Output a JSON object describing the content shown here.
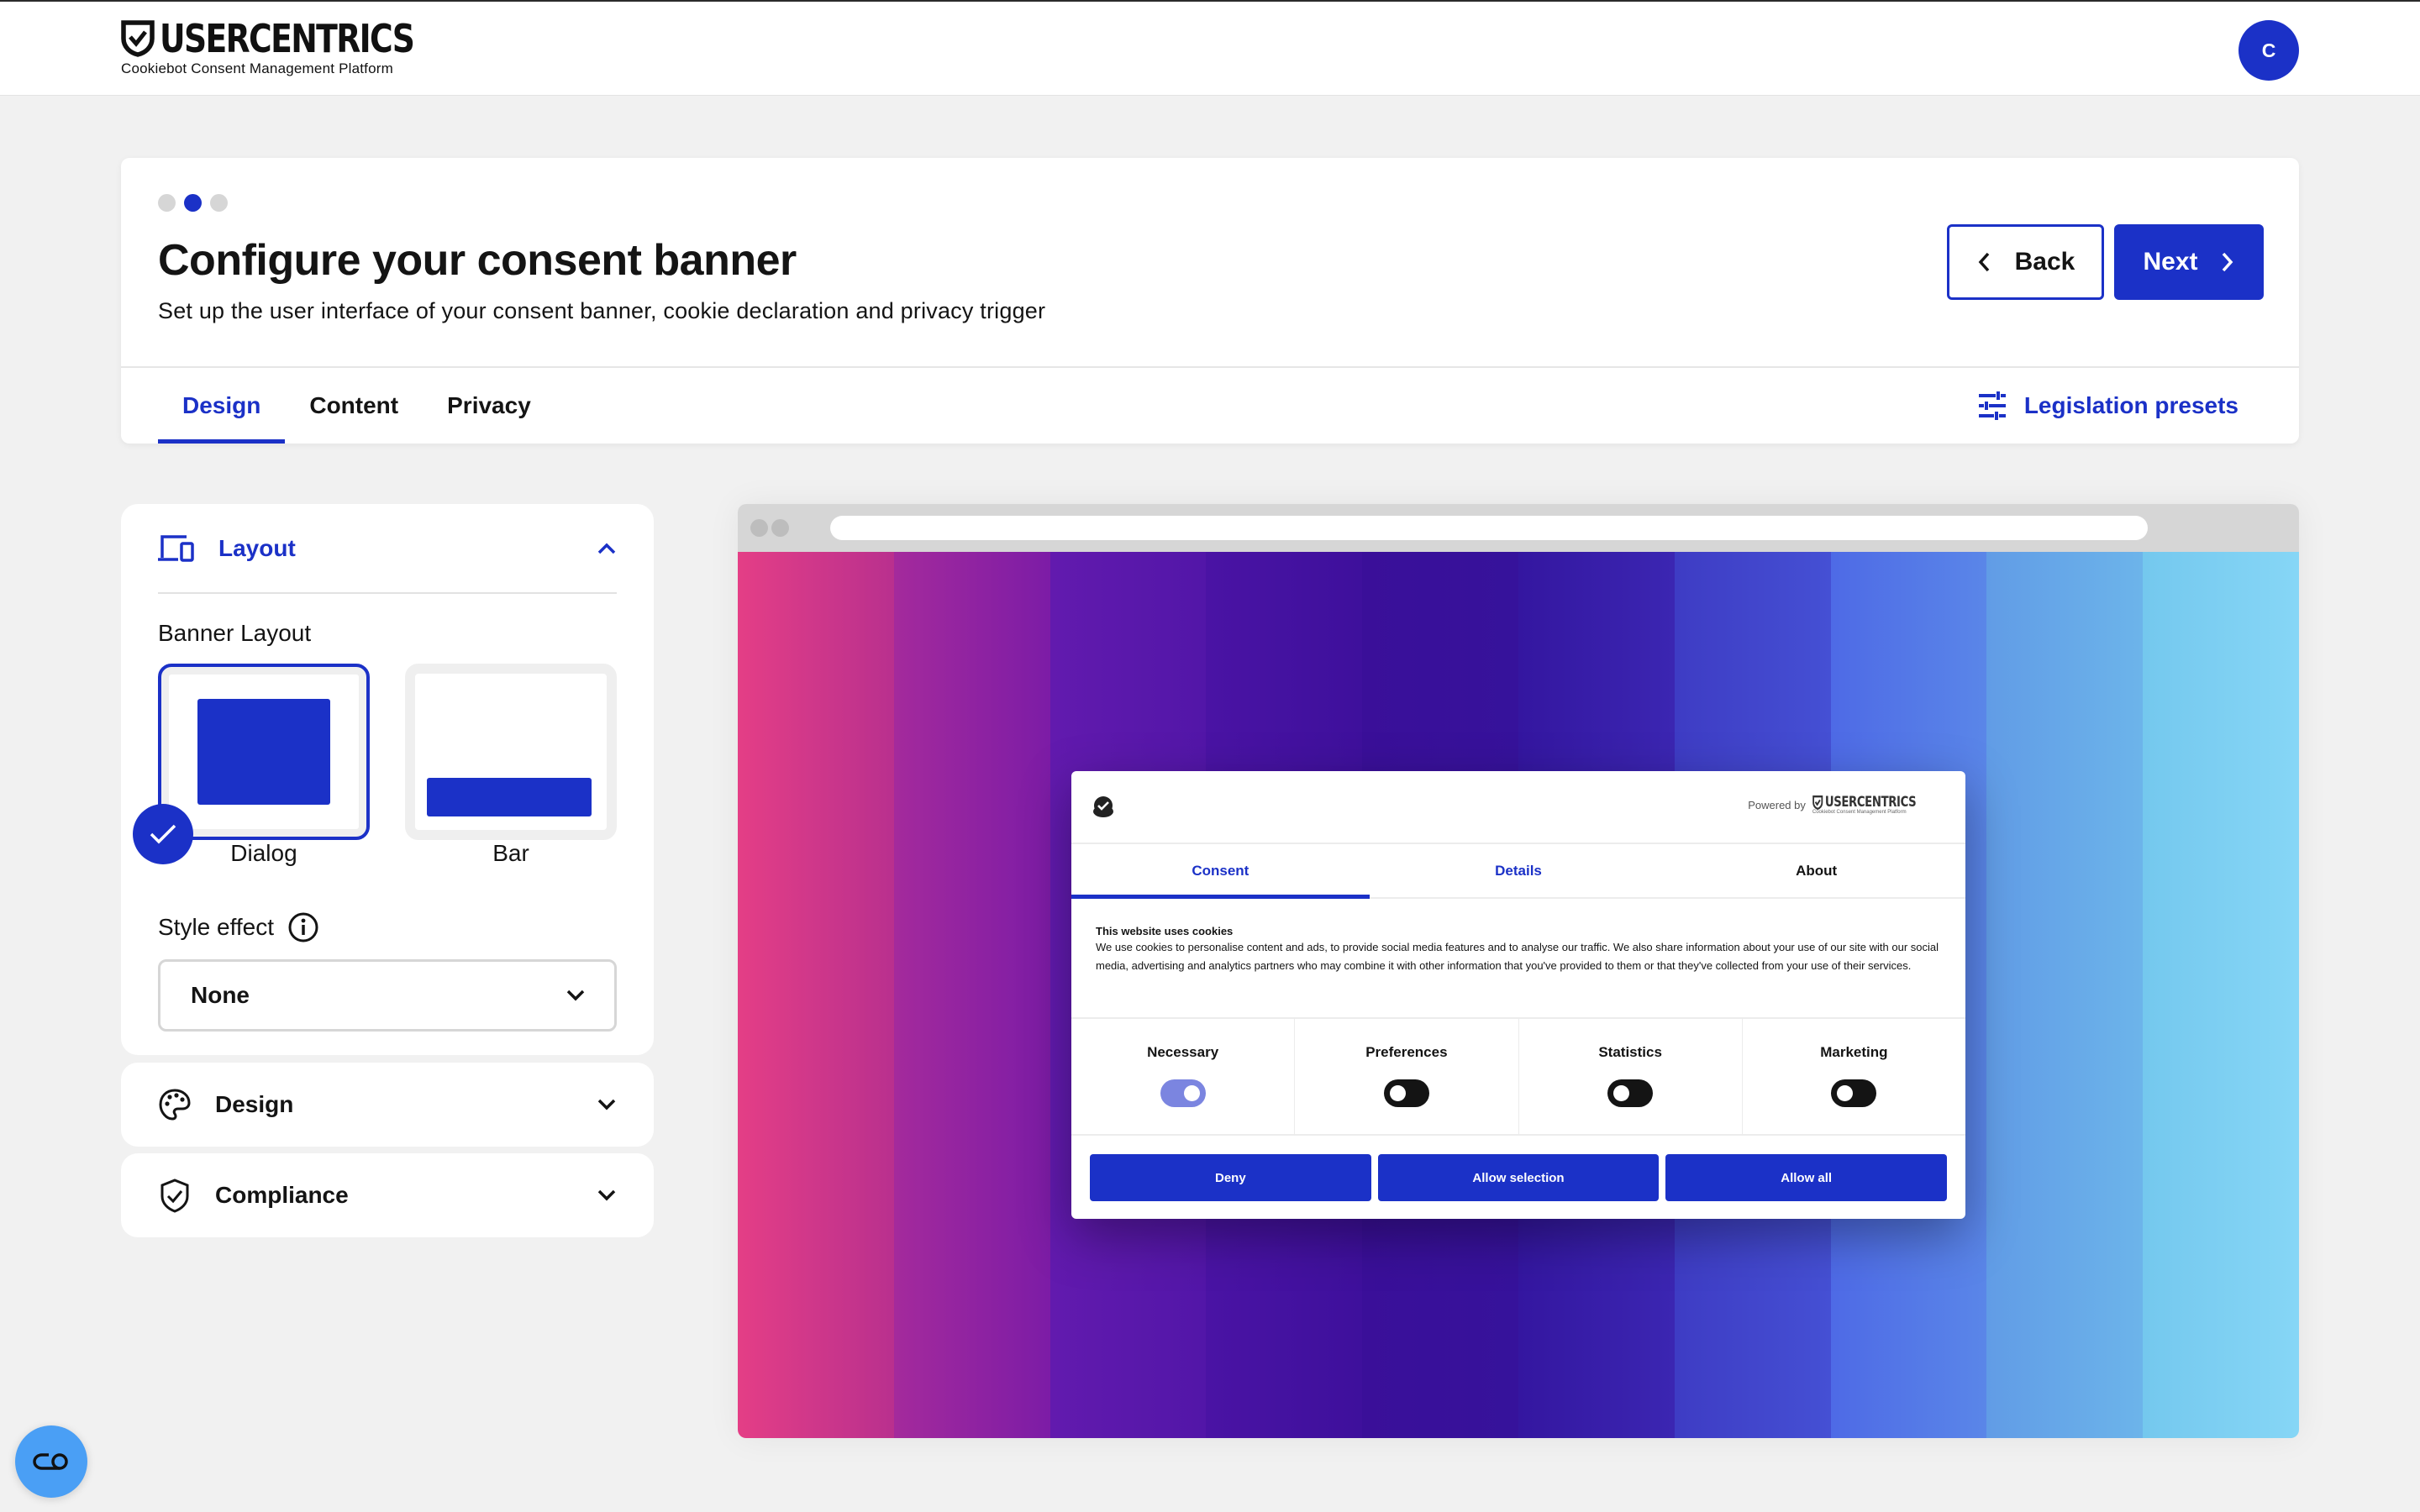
{
  "app": {
    "brand": "USERCENTRICS",
    "brand_subtitle": "Cookiebot Consent Management Platform",
    "avatar_initial": "C",
    "accent_color": "#1b31c7"
  },
  "header": {
    "steps": {
      "total": 3,
      "current": 2
    },
    "title": "Configure your consent banner",
    "subtitle": "Set up the user interface of your consent banner, cookie declaration and privacy trigger",
    "back_label": "Back",
    "next_label": "Next",
    "tabs": [
      {
        "label": "Design",
        "active": true
      },
      {
        "label": "Content",
        "active": false
      },
      {
        "label": "Privacy",
        "active": false
      }
    ],
    "legislation_label": "Legislation presets"
  },
  "sidebar": {
    "layout": {
      "title": "Layout",
      "expanded": true,
      "banner_layout_label": "Banner Layout",
      "options": [
        {
          "label": "Dialog",
          "selected": true
        },
        {
          "label": "Bar",
          "selected": false
        }
      ],
      "style_effect_label": "Style effect",
      "style_effect_value": "None"
    },
    "design": {
      "title": "Design",
      "expanded": false
    },
    "compliance": {
      "title": "Compliance",
      "expanded": false
    }
  },
  "preview": {
    "stripe_colors": [
      [
        "#e43e86",
        "#b9308e"
      ],
      [
        "#a42a9c",
        "#7c1ca6"
      ],
      [
        "#621aae",
        "#5216a8"
      ],
      [
        "#4a13a4",
        "#3e109c"
      ],
      [
        "#3a0f99",
        "#36129b"
      ],
      [
        "#3416a0",
        "#3b26b2"
      ],
      [
        "#3e3cc4",
        "#4550d4"
      ],
      [
        "#4e6ae6",
        "#5a86e8"
      ],
      [
        "#619ce6",
        "#6cb4ea"
      ],
      [
        "#74c8ee",
        "#86d6f6"
      ]
    ],
    "dialog": {
      "powered_by": "Powered by",
      "brand": "USERCENTRICS",
      "brand_subtitle": "Cookiebot Consent Management Platform",
      "tabs": [
        {
          "label": "Consent",
          "active": true
        },
        {
          "label": "Details",
          "active": false
        },
        {
          "label": "About",
          "active": false
        }
      ],
      "body_title": "This website uses cookies",
      "body_text": "We use cookies to personalise content and ads, to provide social media features and to analyse our traffic. We also share information about your use of our site with our social media, advertising and analytics partners who may combine it with other information that you've provided to them or that they've collected from your use of their services.",
      "categories": [
        {
          "label": "Necessary",
          "enabled": true
        },
        {
          "label": "Preferences",
          "enabled": false
        },
        {
          "label": "Statistics",
          "enabled": false
        },
        {
          "label": "Marketing",
          "enabled": false
        }
      ],
      "buttons": [
        "Deny",
        "Allow selection",
        "Allow all"
      ]
    }
  },
  "widget": {
    "icon": "privacy-trigger-icon"
  }
}
